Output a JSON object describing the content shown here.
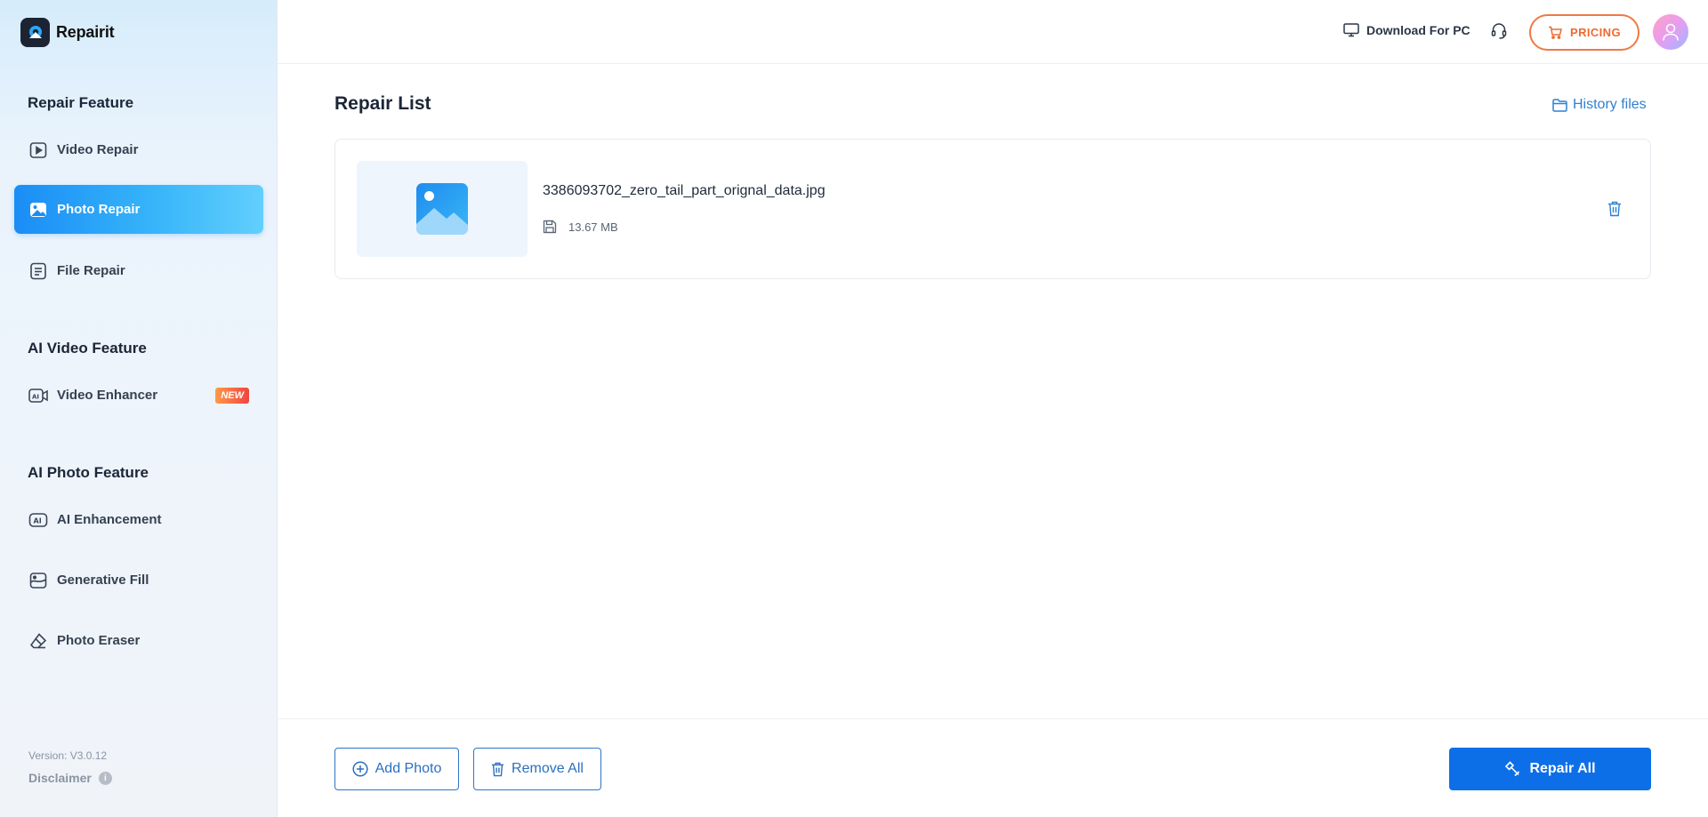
{
  "app": {
    "name": "Repairit"
  },
  "sidebar": {
    "sections": [
      {
        "title": "Repair Feature"
      },
      {
        "title": "AI Video Feature"
      },
      {
        "title": "AI Photo Feature"
      }
    ],
    "items": {
      "video_repair": {
        "label": "Video Repair",
        "icon": "play-icon"
      },
      "photo_repair": {
        "label": "Photo Repair",
        "icon": "image-icon",
        "active": true
      },
      "file_repair": {
        "label": "File Repair",
        "icon": "document-icon"
      },
      "video_enhancer": {
        "label": "Video Enhancer",
        "icon": "ai-video-icon",
        "badge": "NEW"
      },
      "ai_enhancement": {
        "label": "AI Enhancement",
        "icon": "ai-icon"
      },
      "generative_fill": {
        "label": "Generative Fill",
        "icon": "generative-fill-icon"
      },
      "photo_eraser": {
        "label": "Photo Eraser",
        "icon": "eraser-icon"
      }
    },
    "version": "Version: V3.0.12",
    "disclaimer": "Disclaimer"
  },
  "topbar": {
    "download_label": "Download For PC",
    "pricing_label": "PRICING"
  },
  "main": {
    "title": "Repair List",
    "history_label": "History files",
    "files": [
      {
        "name": "3386093702_zero_tail_part_orignal_data.jpg",
        "size": "13.67 MB"
      }
    ]
  },
  "bottom": {
    "add_photo_label": "Add Photo",
    "remove_all_label": "Remove All",
    "repair_all_label": "Repair All"
  },
  "colors": {
    "accent": "#0c6fe8",
    "pricing": "#ee6a2e",
    "active_nav_start": "#1a8df6",
    "active_nav_end": "#62cffd",
    "new_badge": "#f2433f"
  }
}
